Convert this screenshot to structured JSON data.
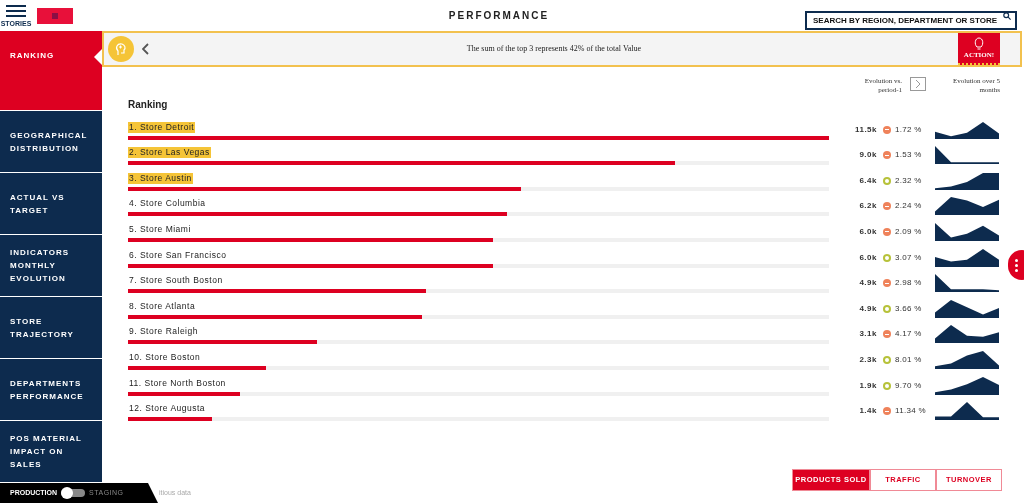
{
  "header": {
    "menu_label": "STORIES",
    "title": "PERFORMANCE",
    "search": {
      "placeholder": "SEARCH BY REGION, DEPARTMENT OR STORE"
    }
  },
  "sidebar": {
    "items": [
      {
        "label": "RANKING",
        "selected": true
      },
      {
        "label": "GEOGRAPHICAL DISTRIBUTION",
        "selected": false
      },
      {
        "label": "ACTUAL VS TARGET",
        "selected": false
      },
      {
        "label": "INDICATORS MONTHLY EVOLUTION",
        "selected": false
      },
      {
        "label": "STORE TRAJECTORY",
        "selected": false
      },
      {
        "label": "DEPARTMENTS PERFORMANCE",
        "selected": false
      },
      {
        "label": "POS MATERIAL IMPACT ON SALES",
        "selected": false
      }
    ]
  },
  "environment": {
    "production_label": "PRODUCTION",
    "staging_label": "STAGING",
    "on": false,
    "note": "itious data"
  },
  "banner": {
    "message": "The sum of the top 3 represents 42% of the total Value",
    "action_label": "ACTION!"
  },
  "ranking": {
    "title": "Ranking",
    "column_evolution": "Evolution vs. period-1",
    "column_trend": "Evolution over 5 months",
    "rows": [
      {
        "name": "1. Store Detroit",
        "highlighted": true,
        "level": 1.0,
        "value": "11.5k",
        "rising": false,
        "evolution": "1.72 %"
      },
      {
        "name": "2. Store Las Vegas",
        "highlighted": true,
        "level": 0.78,
        "value": "9.0k",
        "rising": false,
        "evolution": "1.53 %"
      },
      {
        "name": "3. Store Austin",
        "highlighted": true,
        "level": 0.56,
        "value": "6.4k",
        "rising": true,
        "evolution": "2.32 %"
      },
      {
        "name": "4. Store Columbia",
        "highlighted": false,
        "level": 0.54,
        "value": "6.2k",
        "rising": false,
        "evolution": "2.24 %"
      },
      {
        "name": "5. Store Miami",
        "highlighted": false,
        "level": 0.52,
        "value": "6.0k",
        "rising": false,
        "evolution": "2.09 %"
      },
      {
        "name": "6. Store San Francisco",
        "highlighted": false,
        "level": 0.52,
        "value": "6.0k",
        "rising": true,
        "evolution": "3.07 %"
      },
      {
        "name": "7. Store South Boston",
        "highlighted": false,
        "level": 0.425,
        "value": "4.9k",
        "rising": false,
        "evolution": "2.98 %"
      },
      {
        "name": "8. Store Atlanta",
        "highlighted": false,
        "level": 0.42,
        "value": "4.9k",
        "rising": true,
        "evolution": "3.66 %"
      },
      {
        "name": "9. Store Raleigh",
        "highlighted": false,
        "level": 0.27,
        "value": "3.1k",
        "rising": false,
        "evolution": "4.17 %"
      },
      {
        "name": "10. Store Boston",
        "highlighted": false,
        "level": 0.197,
        "value": "2.3k",
        "rising": true,
        "evolution": "8.01 %"
      },
      {
        "name": "11. Store North Boston",
        "highlighted": false,
        "level": 0.16,
        "value": "1.9k",
        "rising": true,
        "evolution": "9.70 %"
      },
      {
        "name": "12. Store Augusta",
        "highlighted": false,
        "level": 0.12,
        "value": "1.4k",
        "rising": false,
        "evolution": "11.34 %"
      }
    ]
  },
  "metric_tabs": [
    {
      "label": "PRODUCTS SOLD",
      "selected": true
    },
    {
      "label": "TRAFFIC",
      "selected": false
    },
    {
      "label": "TURNOVER",
      "selected": false
    }
  ]
}
